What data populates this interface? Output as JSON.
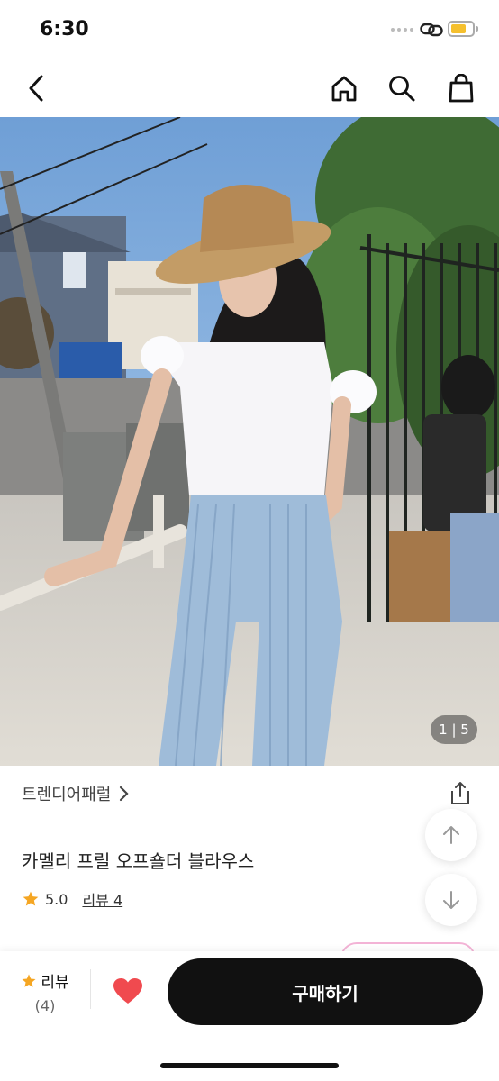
{
  "status_bar": {
    "time": "6:30"
  },
  "product": {
    "image_counter": "1 | 5",
    "seller": "트렌디어패럴",
    "title": "카멜리 프릴 오프숄더 블라우스",
    "rating": "5.0",
    "review_link": "리뷰 4"
  },
  "bottom_bar": {
    "review_label": "리뷰",
    "review_count": "(4)",
    "buy_label": "구매하기"
  },
  "colors": {
    "accent_star": "#f5a623",
    "heart": "#f04a4f",
    "buy_button": "#111111"
  },
  "icons": [
    "back-icon",
    "home-icon",
    "search-icon",
    "bag-icon",
    "share-icon",
    "arrow-up-icon",
    "arrow-down-icon",
    "star-icon",
    "heart-icon"
  ]
}
